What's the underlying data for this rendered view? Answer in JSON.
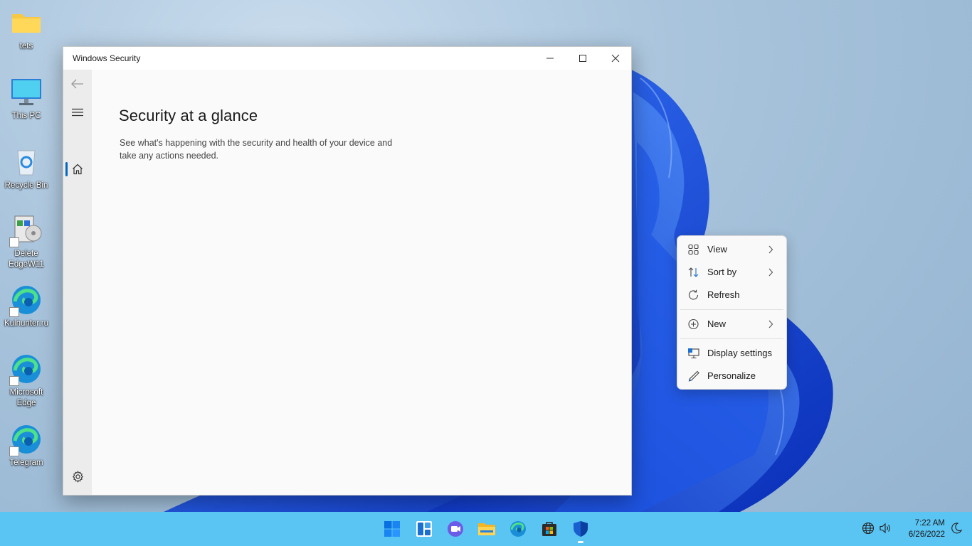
{
  "desktop": {
    "icons": [
      {
        "label": "tets",
        "icon": "folder-icon"
      },
      {
        "label": "This PC",
        "icon": "monitor-icon"
      },
      {
        "label": "Recycle Bin",
        "icon": "recycle-bin-icon"
      },
      {
        "label": "Delete EdgeW11",
        "icon": "installer-icon"
      },
      {
        "label": "Kulhunter.ru",
        "icon": "edge-icon"
      },
      {
        "label": "Microsoft Edge",
        "icon": "edge-icon"
      },
      {
        "label": "Telegram",
        "icon": "edge-icon"
      }
    ]
  },
  "window": {
    "title": "Windows Security",
    "main_title": "Security at a glance",
    "main_desc": "See what's happening with the security and health of your device and take any actions needed.",
    "rail": [
      "back-arrow-icon",
      "hamburger-icon",
      "home-icon",
      "gear-icon"
    ],
    "caption_buttons": [
      "minimize-icon",
      "maximize-icon",
      "close-icon"
    ]
  },
  "context_menu": {
    "items": [
      {
        "label": "View",
        "icon": "grid-icon",
        "submenu": true
      },
      {
        "label": "Sort by",
        "icon": "sort-icon",
        "submenu": true
      },
      {
        "label": "Refresh",
        "icon": "refresh-icon",
        "submenu": false
      },
      {
        "label": "New",
        "icon": "plus-circle-icon",
        "submenu": true
      },
      {
        "label": "Display settings",
        "icon": "display-settings-icon",
        "submenu": false
      },
      {
        "label": "Personalize",
        "icon": "pen-icon",
        "submenu": false
      }
    ]
  },
  "taskbar": {
    "apps": [
      "start-icon",
      "widgets-icon",
      "teams-chat-icon",
      "file-explorer-icon",
      "edge-icon",
      "store-icon",
      "windows-security-icon"
    ],
    "tray": [
      "network-icon",
      "volume-icon",
      "notifications-icon"
    ],
    "time": "7:22 AM",
    "date": "6/26/2022"
  },
  "colors": {
    "accent": "#0067c0",
    "taskbar": "#5ac4f3",
    "wallpaper_blue": "#1a4fd8"
  }
}
